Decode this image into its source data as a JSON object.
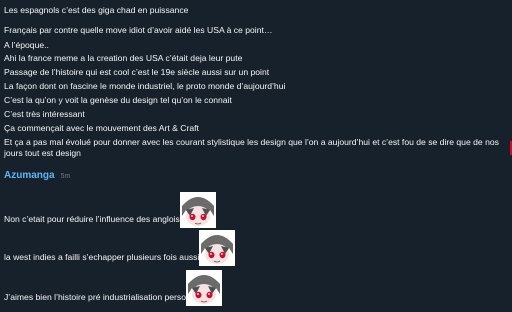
{
  "messages": [
    "Les espagnols c’est des giga chad en puissance",
    "Français par contre quelle move idiot d’avoir aidé les USA à ce point…",
    "A l’époque..",
    "Ahi la france meme a la creation des USA c’était deja leur pute",
    "Passage de l’histoire qui est cool c’est le 19e siècle aussi sur un point",
    "La façon dont on fascine le monde industriel, le proto monde d’aujourd’hui",
    "C’est la qu’on y voit la genèse du design tel qu’on le connait",
    "C’est très intéressant",
    "Ça commençait avec le mouvement des Art & Craft",
    "Et ça a pas mal évolué pour donner avec les courant stylistique les design que l’on a aujourd’hui et c’est fou de se dire que de nos jours tout est design"
  ],
  "author": {
    "name": "Azumanga",
    "time": "5m"
  },
  "author_messages": [
    "Non c’etait pour réduire l’influence des anglois",
    "la west indies a failli s’echapper plusieurs fois aussi",
    "J’aimes bien l’histoire pré industrialisation perso"
  ],
  "colors": {
    "background": "#17212b",
    "author_name": "#5eb5f7",
    "text": "#f5f5f5"
  },
  "sticker_icon": "anime-girl-sticker-icon"
}
